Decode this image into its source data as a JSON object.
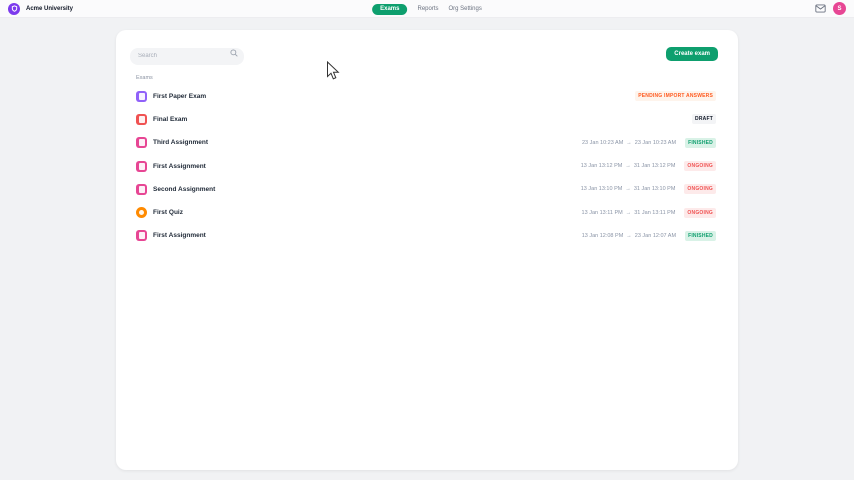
{
  "header": {
    "org_name": "Acme University",
    "tabs": [
      {
        "label": "Exams",
        "active": true
      },
      {
        "label": "Reports",
        "active": false
      },
      {
        "label": "Org Settings",
        "active": false
      }
    ],
    "avatar_initial": "S"
  },
  "toolbar": {
    "search_placeholder": "Search",
    "create_exam_label": "Create exam"
  },
  "exams": {
    "section_label": "Exams",
    "rows": [
      {
        "name": "First Paper Exam",
        "type_class": "paper",
        "status": "PENDING IMPORT ANSWERS",
        "status_class": "pending"
      },
      {
        "name": "Final Exam",
        "type_class": "exam",
        "status": "DRAFT",
        "status_class": "draft"
      },
      {
        "name": "Third Assignment",
        "type_class": "assignment",
        "status": "FINISHED",
        "status_class": "finished",
        "schedule": {
          "start": "23 Jan 10:23 AM",
          "end": "23 Jan 10:23 AM"
        }
      },
      {
        "name": "First Assignment",
        "type_class": "assignment",
        "status": "ONGOING",
        "status_class": "ongoing",
        "schedule": {
          "start": "13 Jan 13:12 PM",
          "end": "31 Jan 13:12 PM"
        }
      },
      {
        "name": "Second Assignment",
        "type_class": "assignment",
        "status": "ONGOING",
        "status_class": "ongoing",
        "schedule": {
          "start": "13 Jan 13:10 PM",
          "end": "31 Jan 13:10 PM"
        }
      },
      {
        "name": "First Quiz",
        "type_class": "quiz",
        "status": "ONGOING",
        "status_class": "ongoing",
        "schedule": {
          "start": "13 Jan 13:11 PM",
          "end": "31 Jan 13:11 PM"
        }
      },
      {
        "name": "First Assignment",
        "type_class": "assignment",
        "status": "FINISHED",
        "status_class": "finished",
        "schedule": {
          "start": "13 Jan 12:08 PM",
          "end": "23 Jan 12:07 AM"
        }
      }
    ]
  },
  "icons": {
    "logo": "shield-icon",
    "mail": "mail-icon",
    "search": "search-icon",
    "arrow_right": "→",
    "cursor": "arrow-cursor"
  },
  "colors": {
    "accent_green": "#0e9f6e",
    "logo_purple": "#7c3aed",
    "avatar_pink": "#e74694",
    "icon_paper": "#9061f9",
    "icon_exam": "#f05252",
    "icon_assignment": "#e74694",
    "icon_quiz": "#ff8a00",
    "status_pending": "#ff5a1f",
    "status_draft": "#111827",
    "status_finished": "#0e9f6e",
    "status_ongoing": "#f05252",
    "page_bg": "#f1f2f4",
    "card_bg": "#ffffff"
  }
}
